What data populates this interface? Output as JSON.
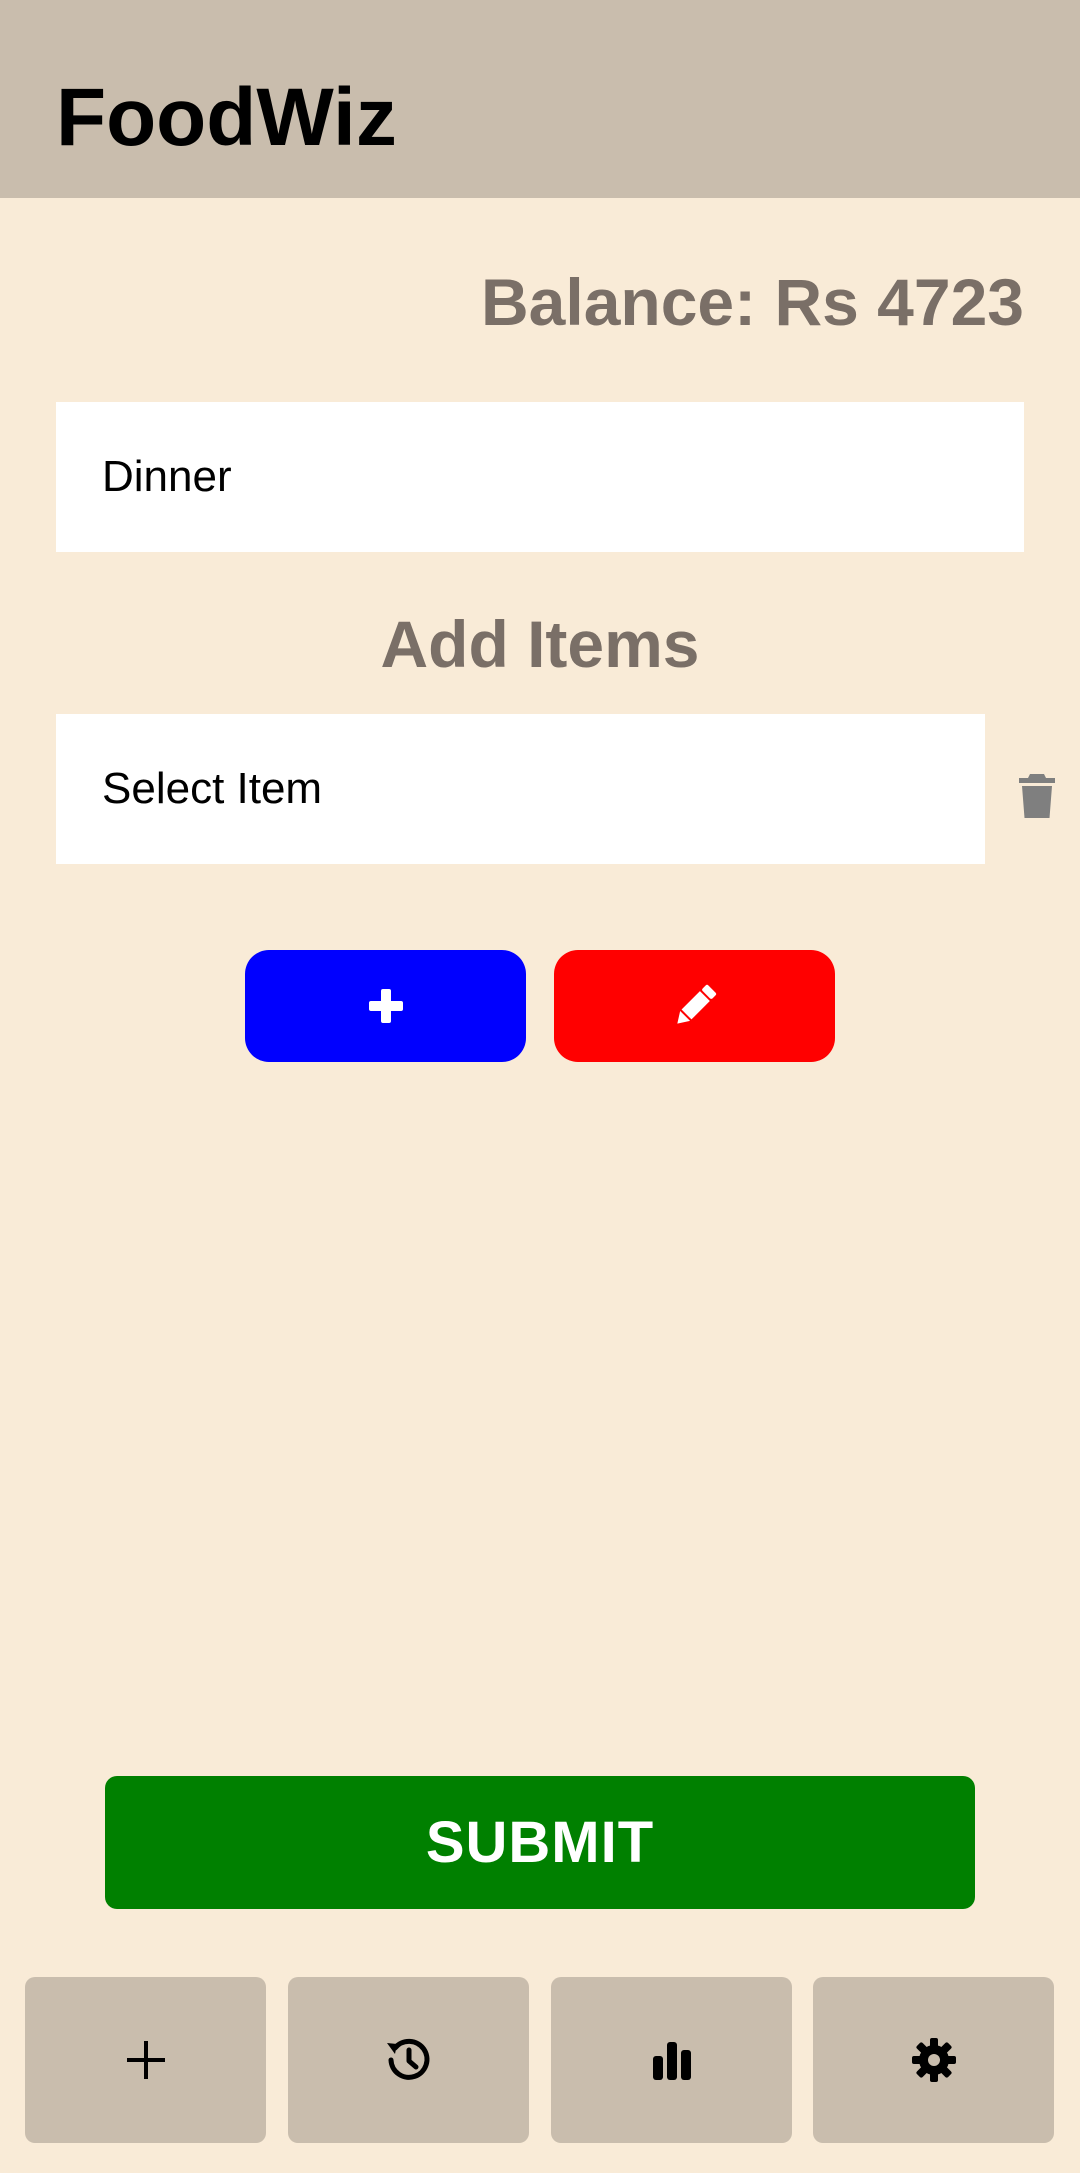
{
  "header": {
    "app_title": "FoodWiz"
  },
  "balance": {
    "text": "Balance: Rs 4723"
  },
  "meal": {
    "value": "Dinner"
  },
  "add_items": {
    "heading": "Add Items",
    "select_placeholder": "Select Item"
  },
  "buttons": {
    "add_icon": "plus-icon",
    "edit_icon": "pencil-icon",
    "delete_icon": "trash-icon",
    "submit_label": "SUBMIT"
  },
  "bottom_nav": {
    "items": [
      {
        "icon": "plus-icon"
      },
      {
        "icon": "history-icon"
      },
      {
        "icon": "bar-chart-icon"
      },
      {
        "icon": "gear-icon"
      }
    ]
  },
  "colors": {
    "app_bar": "#c9bdad",
    "background": "#f9ebd7",
    "add_button": "#0000ff",
    "edit_button": "#ff0000",
    "submit_button": "#008000",
    "muted_text": "#7a6f67"
  }
}
